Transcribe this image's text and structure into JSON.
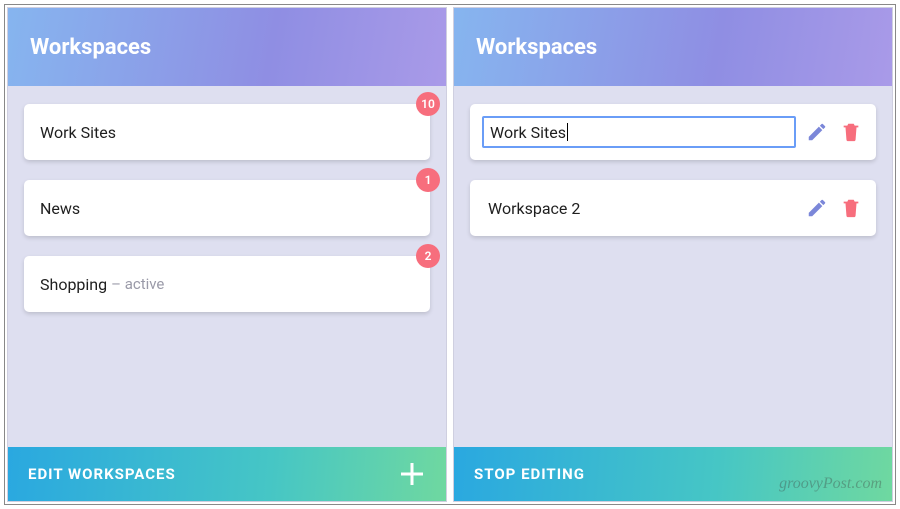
{
  "left": {
    "header_title": "Workspaces",
    "items": [
      {
        "name": "Work Sites",
        "badge": "10",
        "suffix": ""
      },
      {
        "name": "News",
        "badge": "1",
        "suffix": ""
      },
      {
        "name": "Shopping",
        "badge": "2",
        "suffix": " – active"
      }
    ],
    "footer_label": "EDIT WORKSPACES"
  },
  "right": {
    "header_title": "Workspaces",
    "items": [
      {
        "name": "Work Sites",
        "editing": true
      },
      {
        "name": "Workspace 2",
        "editing": false
      }
    ],
    "footer_label": "STOP EDITING"
  },
  "watermark": "groovyPost.com"
}
